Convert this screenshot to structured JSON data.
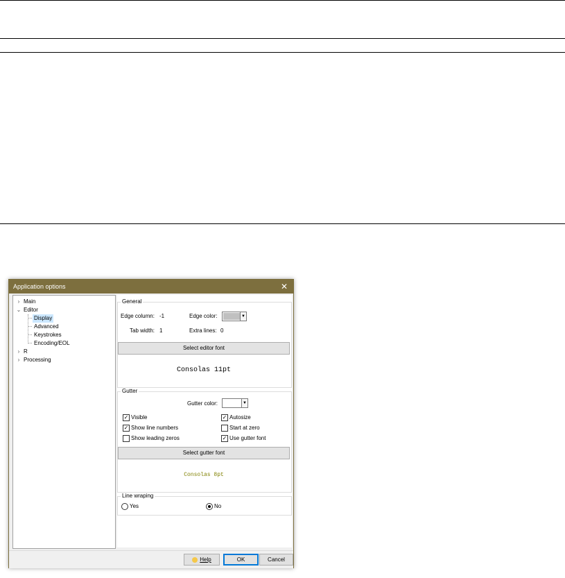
{
  "dialog": {
    "title": "Application options",
    "close_glyph": "✕"
  },
  "tree": {
    "main": "Main",
    "editor": "Editor",
    "display": "Display",
    "advanced": "Advanced",
    "keystrokes": "Keystrokes",
    "encoding": "Encoding/EOL",
    "r": "R",
    "processing": "Processing",
    "collapsed_glyph": "›",
    "expanded_glyph": "⌄"
  },
  "general": {
    "group_label": "General",
    "edge_column_label": "Edge column:",
    "edge_column_value": "-1",
    "edge_color_label": "Edge color:",
    "edge_color": "#c0c0c0",
    "tab_width_label": "Tab width:",
    "tab_width_value": "1",
    "extra_lines_label": "Extra lines:",
    "extra_lines_value": "0",
    "select_font_button": "Select editor font",
    "font_preview": "Consolas 11pt"
  },
  "gutter": {
    "group_label": "Gutter",
    "gutter_color_label": "Gutter color:",
    "gutter_color": "#ffffff",
    "visible": "Visible",
    "autosize": "Autosize",
    "show_line_numbers": "Show line numbers",
    "start_at_zero": "Start at zero",
    "show_leading_zeros": "Show leading zeros",
    "use_gutter_font": "Use gutter font",
    "select_font_button": "Select gutter font",
    "font_preview": "Consolas 8pt",
    "preview_color": "#808000",
    "check_glyph": "✓"
  },
  "wrapping": {
    "group_label": "Line wraping",
    "yes": "Yes",
    "no": "No"
  },
  "footer": {
    "help": "Help",
    "ok": "OK",
    "cancel": "Cancel"
  }
}
